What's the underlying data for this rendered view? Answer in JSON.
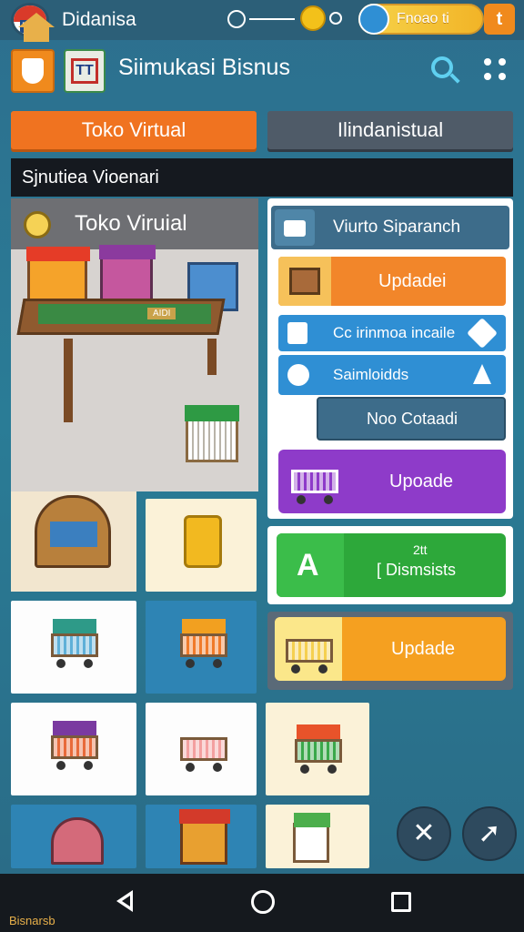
{
  "status_bar": {
    "app_name": "Didanisa",
    "profile_name": "Fnoao ti",
    "profile_action": "t"
  },
  "header": {
    "title": "Siimukasi Bisnus"
  },
  "tabs": [
    {
      "label": "Toko Virtual",
      "active": true
    },
    {
      "label": "Ilindanistual",
      "active": false
    }
  ],
  "section": {
    "title": "Sjnutiea Vioenari"
  },
  "scene": {
    "title": "Toko Viruial",
    "desk_sign": "AIDI"
  },
  "right_panel": {
    "search_row": "Viurto Siparanch",
    "update_1": "Updadei",
    "row_a": "Cc irinmoa incaile",
    "row_b": "Saimloidds",
    "no_content": "Noo Cotaadi",
    "update_2": "Upoade",
    "green_small": "2tt",
    "green_label": "[ Dismsists",
    "update_3": "Updade"
  },
  "fab": {
    "close": "✕",
    "next": "➚"
  },
  "nav": {
    "home_label": "Bisnarsb"
  },
  "colors": {
    "tab_active": "#f07320",
    "tab_inactive": "#4f5b68",
    "orange": "#f2862a",
    "purple": "#8e3bc9",
    "green": "#2da83a",
    "blue": "#2f8fd4"
  }
}
